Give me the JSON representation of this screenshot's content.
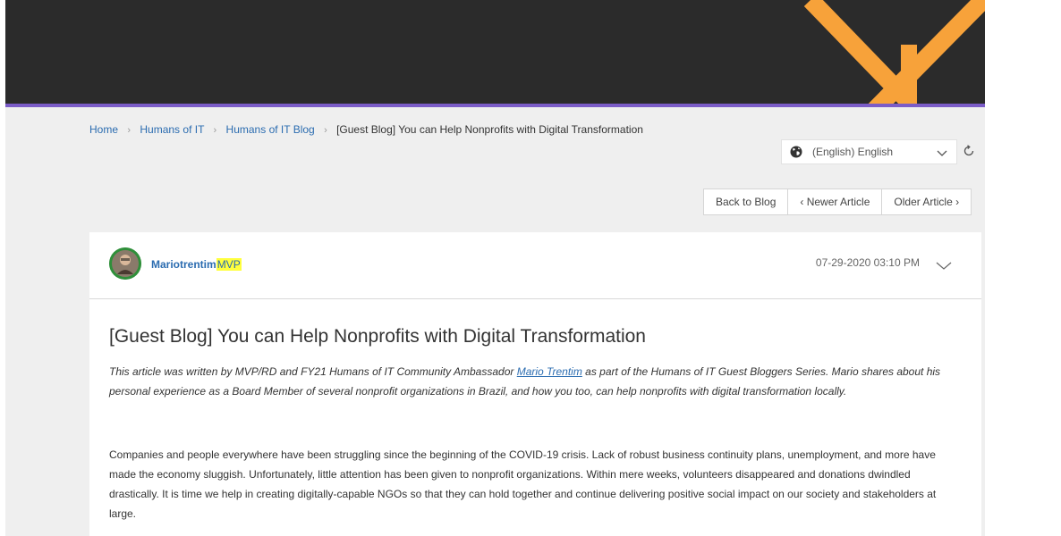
{
  "breadcrumb": {
    "home": "Home",
    "humans_of_it": "Humans of IT",
    "blog": "Humans of IT Blog",
    "current": "[Guest Blog] You can Help Nonprofits with Digital Transformation"
  },
  "language": {
    "selected": "(English) English"
  },
  "nav": {
    "back": "Back to Blog",
    "newer": "‹  Newer Article",
    "older": "Older Article  ›"
  },
  "post": {
    "author": "Mariotrentim",
    "badge": "MVP",
    "date": "07-29-2020 03:10 PM",
    "title": "[Guest Blog] You can Help Nonprofits with Digital Transformation",
    "intro_pre": "This article was written by MVP/RD and FY21 Humans of IT Community Ambassador ",
    "intro_link": "Mario Trentim",
    "intro_post": " as part of the Humans of IT Guest Bloggers Series. Mario shares about his personal experience as a Board Member of several nonprofit organizations in Brazil, and how you too, can help nonprofits with digital transformation locally.",
    "paragraph": "Companies and people everywhere have been struggling since the beginning of the COVID-19 crisis. Lack of robust business continuity plans, unemployment, and more have made the economy sluggish. Unfortunately, little attention has been given to nonprofit organizations. Within mere weeks, volunteers disappeared and donations dwindled drastically. It is time we help in creating digitally-capable NGOs so that they can hold together and continue delivering positive social impact on our society and stakeholders at large."
  },
  "colors": {
    "banner": "#2b2b2b",
    "banner_accent": "#f7a23a",
    "divider": "#7b5cc7",
    "link": "#2b6cb0",
    "highlight": "#ffff3d"
  }
}
